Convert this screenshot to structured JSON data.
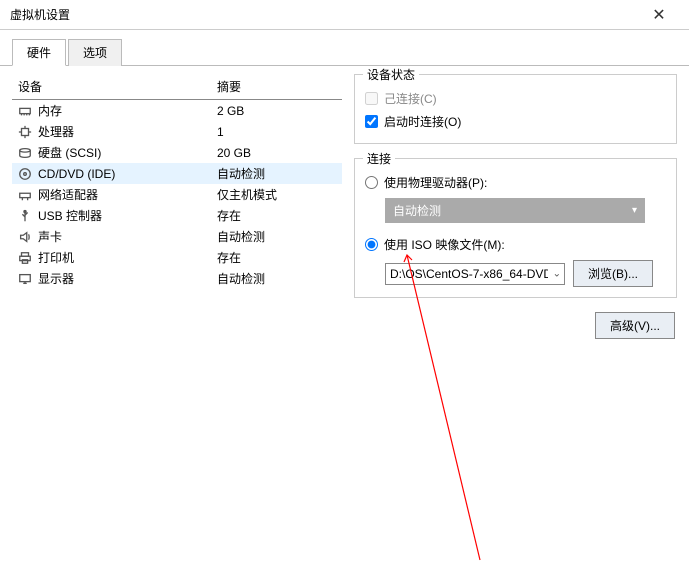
{
  "window": {
    "title": "虚拟机设置",
    "close_glyph": "✕"
  },
  "tabs": {
    "hardware": "硬件",
    "options": "选项"
  },
  "table": {
    "header_device": "设备",
    "header_summary": "摘要"
  },
  "devices": [
    {
      "icon": "memory-icon",
      "name": "内存",
      "summary": "2 GB"
    },
    {
      "icon": "cpu-icon",
      "name": "处理器",
      "summary": "1"
    },
    {
      "icon": "disk-icon",
      "name": "硬盘 (SCSI)",
      "summary": "20 GB"
    },
    {
      "icon": "cd-icon",
      "name": "CD/DVD (IDE)",
      "summary": "自动检测",
      "selected": true
    },
    {
      "icon": "network-icon",
      "name": "网络适配器",
      "summary": "仅主机模式"
    },
    {
      "icon": "usb-icon",
      "name": "USB 控制器",
      "summary": "存在"
    },
    {
      "icon": "sound-icon",
      "name": "声卡",
      "summary": "自动检测"
    },
    {
      "icon": "printer-icon",
      "name": "打印机",
      "summary": "存在"
    },
    {
      "icon": "display-icon",
      "name": "显示器",
      "summary": "自动检测"
    }
  ],
  "status": {
    "legend": "设备状态",
    "connected_label": "己连接(C)",
    "connect_at_power_label": "启动时连接(O)"
  },
  "connection": {
    "legend": "连接",
    "physical_label": "使用物理驱动器(P):",
    "auto_detect_label": "自动检测",
    "iso_label": "使用 ISO 映像文件(M):",
    "iso_value": "D:\\OS\\CentOS-7-x86_64-DVD-",
    "browse_label": "浏览(B)..."
  },
  "advanced_label": "高级(V)..."
}
